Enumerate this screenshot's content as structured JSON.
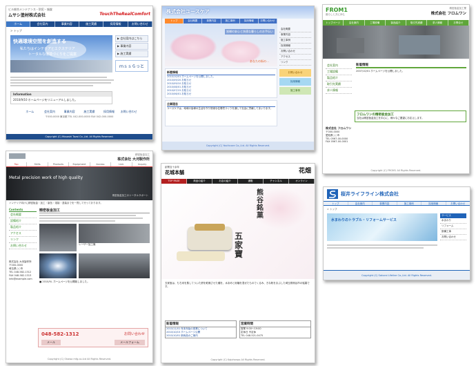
{
  "s1": {
    "tagline": "ビル総合メンテナンス・防犯・施錠",
    "company": "ムサシ塗材株式会社",
    "brand": "TouchTheRealComfort",
    "nav": [
      "ホーム",
      "会社案内",
      "事業内容",
      "施工実績",
      "採用情報",
      "お問い合わせ"
    ],
    "crumb": "> トップ",
    "hero1": "快適環境空間を創造する",
    "hero2": "私たちはインテリアとエクステリア",
    "hero3": "トータルな環境づくりをご提案",
    "menu": [
      "▶ 会社案内はこちら",
      "▶ 事業内容",
      "▶ 施工実績"
    ],
    "badge": "ｍｓｓらっと",
    "info_title": "Information",
    "info_item": "2010/9/10 ホームページをリニューアルしました。",
    "footer_links": [
      "ホーム",
      "会社案内",
      "事業内容",
      "施工実績",
      "採用情報",
      "お問い合わせ"
    ],
    "footer_address": "〒000-0000 東京都 TEL 042-000-0000 FAX 042-000-0000",
    "copyright": "Copyright (C) Musashi Tozai Co.,Ltd. All Rights Reserved."
  },
  "s2": {
    "title": "株式会社ユースケア",
    "nav": [
      "トップ",
      "会社概要",
      "事業内容",
      "施工事例",
      "採用情報",
      "お問い合わせ"
    ],
    "hero_text": "皆様の安心と快適な暮らしのお手伝い",
    "hero_sub": "あなたの街の…",
    "news_title": "新着情報",
    "news": [
      "2010/10/01 ホームページを公開しました。",
      "2010/09/20 お知らせ",
      "2010/09/10 お知らせ",
      "2010/08/01 お知らせ",
      "2010/07/15 お知らせ",
      "2010/06/01 お知らせ"
    ],
    "side": [
      "会社概要",
      "事業内容",
      "施工事例",
      "採用情報",
      "お問い合わせ",
      "アクセス",
      "リンク"
    ],
    "banner1": "お問い合わせ",
    "banner2": "採用情報",
    "banner3": "施工事例",
    "about_title": "企業理念",
    "about": "ユースケアは、地域の皆様の生活を守り快適な住環境づくりを通して社会に貢献してまいります。",
    "footer": "Copyright (C) Youthcare Co.,Ltd. All Rights Reserved."
  },
  "s3": {
    "logo": "FROM1",
    "logo_sub": "暮らしと共に歩む",
    "company_small": "精密板金加工業",
    "company": "株式会社 フロムワン",
    "nav": [
      "トップページ",
      "会社案内",
      "工場設備",
      "製品紹介",
      "取引先実績",
      "求人情報",
      "お問合せ"
    ],
    "side": [
      "会社案内",
      "工場設備",
      "製品紹介",
      "取引先実績",
      "求人情報"
    ],
    "news_title": "新着情報",
    "news_item": "2007/10/01 ホームページを公開しました。",
    "box_title": "フロムワンの精密板金加工",
    "box_text": "当社は精密板金加工を中心に、様々なご要望にお応えします。",
    "addr_title": "株式会社 フロムワン",
    "addr": [
      "〒000-0000",
      "愛知県○○市",
      "TEL 0567-00-0000",
      "FAX 0567-00-0001"
    ],
    "footer": "Copyright (C) FROM1 All Rights Reserved."
  },
  "s4": {
    "company_small": "精密板金加工",
    "company": "株式会社 大河製作所",
    "nav": [
      "Top",
      "Skills",
      "Products",
      "Equipment",
      "Access",
      "Link",
      "Inquiry"
    ],
    "hero": "Metal precision work of high quality",
    "hero_sub": "精密板金加工のトータルサポート",
    "intro": "インテリア向けに精密板金・加工・製缶・溶接・塗装までを一貫して行っております。",
    "side_title": "Contents",
    "side": [
      "会社概要",
      "設備紹介",
      "製品紹介",
      "アクセス",
      "リンク",
      "お問い合わせ"
    ],
    "section": "精密板金加工",
    "caption1": "レーザー加工機",
    "caption2": "ベンダー",
    "news": "■ 2010/9/- ホームページを公開致しました。",
    "addr": [
      "株式会社 大河製作所",
      "〒000-0000",
      "埼玉県○○市",
      "TEL 048-582-1312",
      "FAX 048-582-1313",
      "info@example.com"
    ],
    "tel": "048-582-1312",
    "contact_label": "お問い合わせ",
    "mail": "メール",
    "form": "メールフォーム",
    "footer": "Copyright (C) Okawa mfg.co.Ltd All Rights Reserved."
  },
  "s5": {
    "maker": "創業百十余年",
    "shop": "花城本舗",
    "kanji": "花畑",
    "nav": [
      "TOP PAGE",
      "商品の紹介",
      "お店の紹介",
      "通販",
      "チャンネル",
      "オンライン"
    ],
    "product": "熊谷銘菓",
    "product_name": "五家寶",
    "intro": "五家宝は、もち米を蒸してついた餅を乾燥させた種を、水あめと砂糖を混ぜたものでくるみ、きな粉をまぶした埼玉県熊谷市の銘菓です。",
    "news_title": "新着情報",
    "hours_title": "営業時間",
    "news": [
      "2010/11/01 年末年始の営業について",
      "2010/10/15 ホームページ公開",
      "2010/10/01 新商品のご案内"
    ],
    "hours": [
      "営業 9:00～19:00",
      "定休日 不定休",
      "TEL 048-521-0475"
    ],
    "footer": "Copyright (C) Kajohonpo All Rights Reserved."
  },
  "s6": {
    "company": "桜井ライフライン株式会社",
    "nav": [
      "トップ",
      "会社案内",
      "事業内容",
      "施工事例",
      "採用情報",
      "お問い合わせ"
    ],
    "crumb": "> トップ",
    "hero": "水まわりのトラブル・リフォームサービス",
    "side_title": "サービス",
    "side": [
      "水まわり",
      "リフォーム",
      "設備工事",
      "お問い合わせ"
    ],
    "footer": "Copyright (C) Sakurai Lifeline Co.,Ltd. All Rights Reserved."
  }
}
